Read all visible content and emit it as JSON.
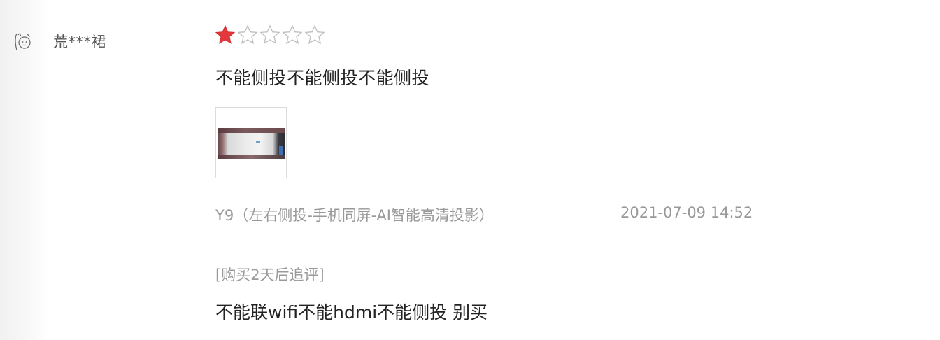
{
  "review": {
    "avatar_icon": "doodle-face-icon",
    "username": "荒***裙",
    "rating": 1,
    "rating_max": 5,
    "star_color_filled": "#e4393c",
    "star_color_empty": "#cccccc",
    "content": "不能侧投不能侧投不能侧投",
    "image_count": 1,
    "variant": "Y9（左右侧投-手机同屏-AI智能高清投影）",
    "timestamp": "2021-07-09 14:52"
  },
  "followup": {
    "label": "[购买2天后追评]",
    "content": "不能联wifi不能hdmi不能侧投 别买"
  }
}
